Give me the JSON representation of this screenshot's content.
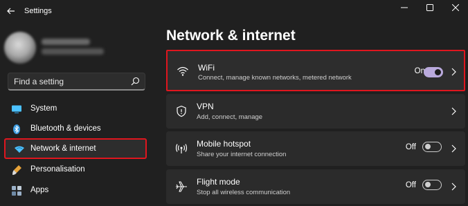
{
  "window": {
    "title": "Settings",
    "controls": [
      "minimize-icon",
      "maximize-icon",
      "close-icon"
    ]
  },
  "sidebar": {
    "search_placeholder": "Find a setting",
    "items": [
      {
        "label": "System",
        "icon": "monitor-icon",
        "selected": false
      },
      {
        "label": "Bluetooth & devices",
        "icon": "bluetooth-icon",
        "selected": false
      },
      {
        "label": "Network & internet",
        "icon": "wifi-diamond-icon",
        "selected": true
      },
      {
        "label": "Personalisation",
        "icon": "paintbrush-icon",
        "selected": false
      },
      {
        "label": "Apps",
        "icon": "apps-icon",
        "selected": false
      }
    ]
  },
  "main": {
    "title": "Network & internet",
    "cards": [
      {
        "title": "WiFi",
        "description": "Connect, manage known networks, metered network",
        "status": "On",
        "toggle": "on",
        "icon": "wifi-icon",
        "highlighted": true
      },
      {
        "title": "VPN",
        "description": "Add, connect, manage",
        "status": "",
        "toggle": "none",
        "icon": "shield-icon",
        "highlighted": false
      },
      {
        "title": "Mobile hotspot",
        "description": "Share your internet connection",
        "status": "Off",
        "toggle": "off",
        "icon": "hotspot-icon",
        "highlighted": false
      },
      {
        "title": "Flight mode",
        "description": "Stop all wireless communication",
        "status": "Off",
        "toggle": "off",
        "icon": "airplane-icon",
        "highlighted": false
      }
    ]
  },
  "colors": {
    "background": "#202020",
    "card": "#2b2b2b",
    "accent_toggle": "#b9a9dc",
    "highlight_border": "#e0161e"
  }
}
